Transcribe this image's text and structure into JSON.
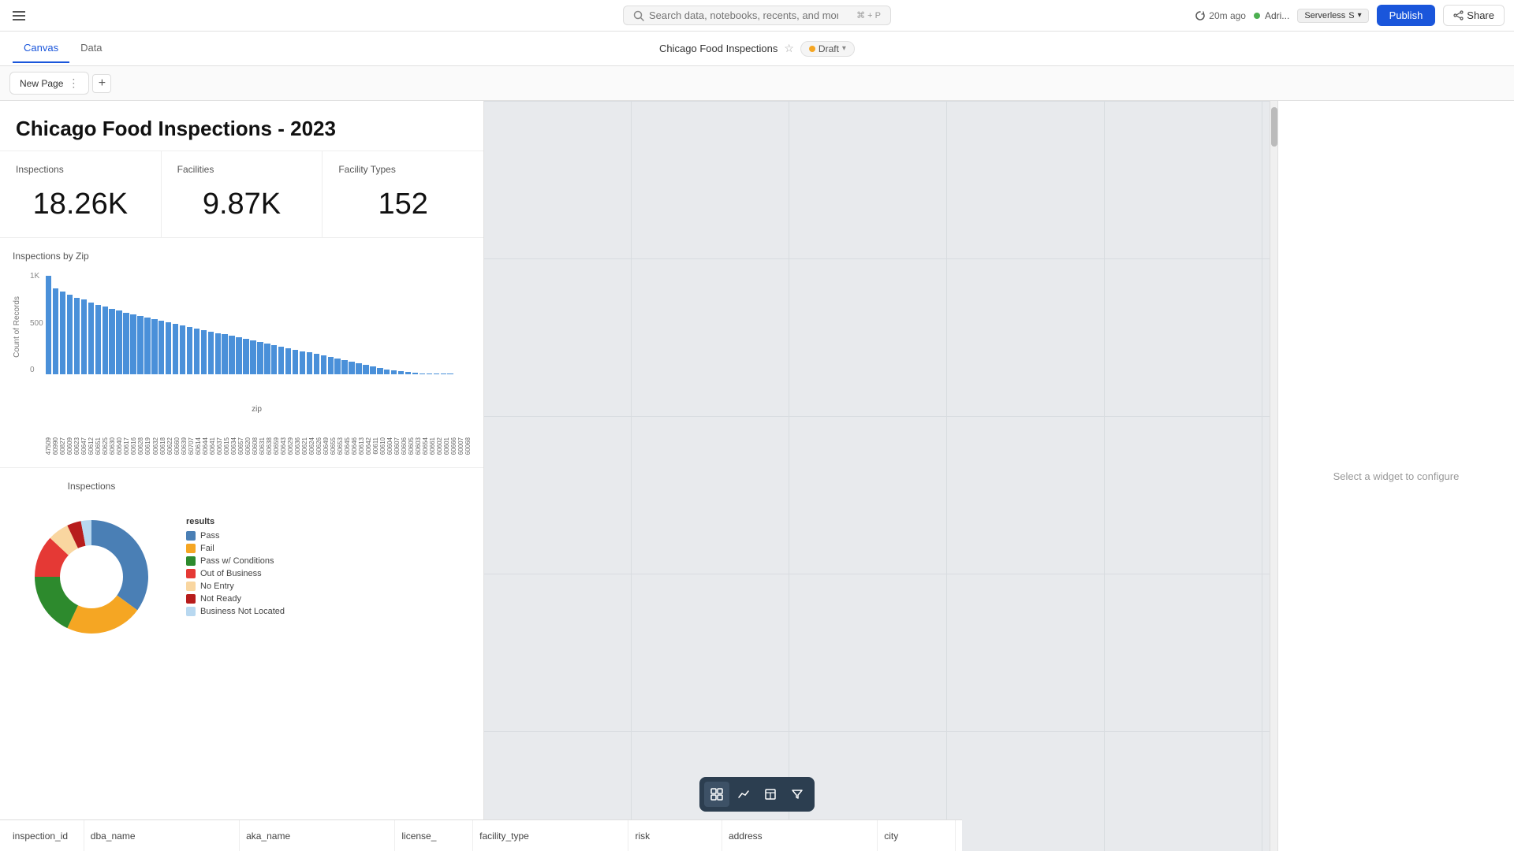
{
  "topbar": {
    "search_placeholder": "Search data, notebooks, recents, and more...",
    "search_shortcut": "⌘ + P",
    "sync_label": "20m ago",
    "user_label": "Adri...",
    "serverless_label": "Serverless",
    "serverless_size": "S",
    "publish_label": "Publish",
    "share_label": "Share"
  },
  "secondbar": {
    "tabs": [
      {
        "label": "Canvas",
        "active": true
      },
      {
        "label": "Data",
        "active": false
      }
    ],
    "doc_title": "Chicago Food Inspections",
    "draft_label": "Draft"
  },
  "page_tabs": {
    "tab_label": "New Page",
    "add_label": "+"
  },
  "dashboard": {
    "title": "Chicago Food Inspections - 2023",
    "kpis": [
      {
        "label": "Inspections",
        "value": "18.26K"
      },
      {
        "label": "Facilities",
        "value": "9.87K"
      },
      {
        "label": "Facility Types",
        "value": "152"
      }
    ],
    "bar_chart": {
      "title": "Inspections by Zip",
      "y_labels": [
        "1K",
        "500",
        "0"
      ],
      "x_label": "zip",
      "axis_y": "Count of Records"
    },
    "donut_chart": {
      "title": "Inspections",
      "legend_title": "results",
      "segments": [
        {
          "label": "Pass",
          "color": "#4a7fb5",
          "pct": 35
        },
        {
          "label": "Fail",
          "color": "#f5a623",
          "pct": 22
        },
        {
          "label": "Pass w/ Conditions",
          "color": "#2d8a2d",
          "pct": 18
        },
        {
          "label": "Out of Business",
          "color": "#e53935",
          "pct": 12
        },
        {
          "label": "No Entry",
          "color": "#f9d6a0",
          "pct": 6
        },
        {
          "label": "Not Ready",
          "color": "#b71c1c",
          "pct": 4
        },
        {
          "label": "Business Not Located",
          "color": "#b8d8f0",
          "pct": 3
        }
      ]
    }
  },
  "bottom_toolbar": {
    "buttons": [
      {
        "icon": "⚡",
        "name": "widget-icon"
      },
      {
        "icon": "📈",
        "name": "chart-icon"
      },
      {
        "icon": "⬜",
        "name": "layout-icon"
      },
      {
        "icon": "🔽",
        "name": "filter-icon"
      }
    ]
  },
  "table_header": {
    "columns": [
      "inspection_id",
      "dba_name",
      "aka_name",
      "license_",
      "facility_type",
      "risk",
      "address",
      "city"
    ]
  },
  "config_panel": {
    "hint": "Select a widget to configure"
  }
}
